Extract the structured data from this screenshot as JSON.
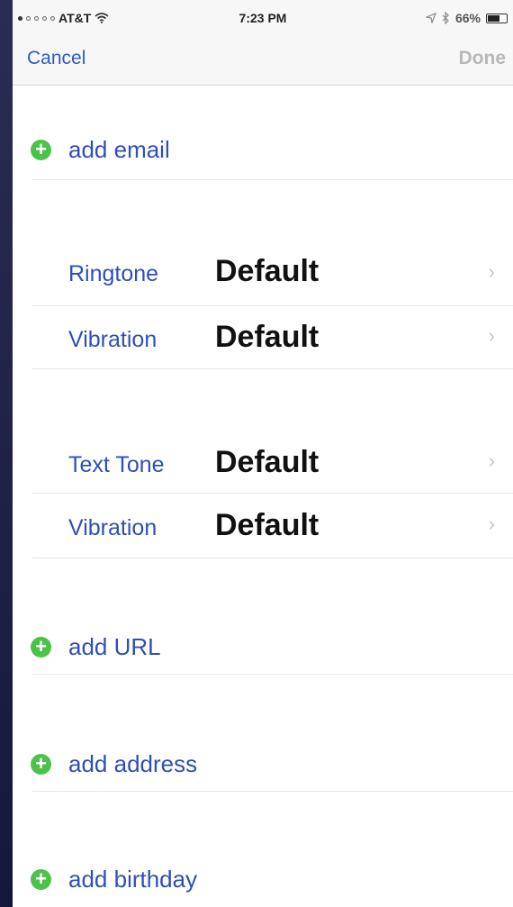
{
  "status_bar": {
    "carrier": "AT&T",
    "time": "7:23 PM",
    "battery": "66%",
    "battery_level": 0.66
  },
  "nav": {
    "cancel": "Cancel",
    "done": "Done"
  },
  "add_email": "add email",
  "ringtone": {
    "label": "Ringtone",
    "value": "Default"
  },
  "ringtone_vibration": {
    "label": "Vibration",
    "value": "Default"
  },
  "text_tone": {
    "label": "Text Tone",
    "value": "Default"
  },
  "text_tone_vibration": {
    "label": "Vibration",
    "value": "Default"
  },
  "add_url": "add URL",
  "add_address": "add address",
  "add_birthday": "add birthday",
  "colors": {
    "link_blue": "#2f4fb8",
    "add_green": "#4cc24a",
    "done_disabled": "#b8b8b8"
  },
  "icons": {
    "add": "plus-circle-icon",
    "disclosure": "chevron-right-icon",
    "wifi": "wifi-icon",
    "location": "location-arrow-icon",
    "bluetooth": "bluetooth-icon",
    "battery": "battery-icon"
  }
}
